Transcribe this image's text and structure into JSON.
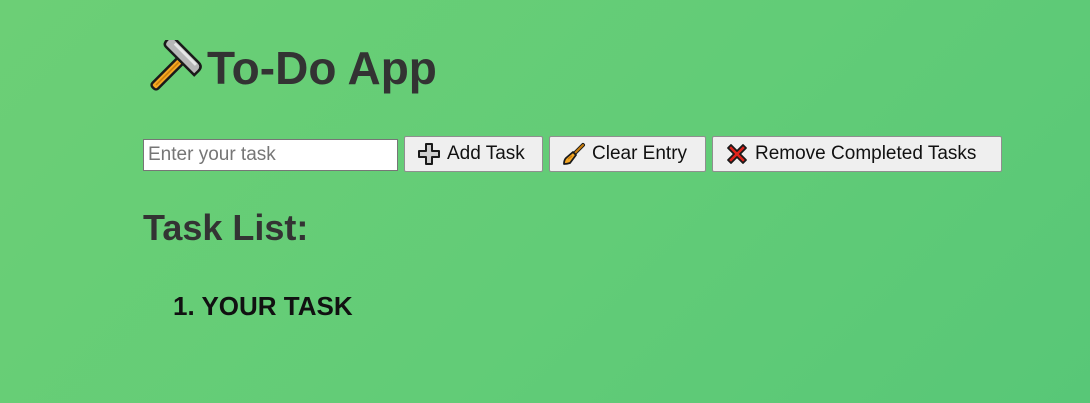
{
  "header": {
    "title": "To-Do App",
    "icon": "hammer-icon"
  },
  "toolbar": {
    "input": {
      "placeholder": "Enter your task",
      "value": ""
    },
    "add_label": "Add Task",
    "add_icon": "plus-icon",
    "clear_label": "Clear Entry",
    "clear_icon": "broom-icon",
    "remove_label": "Remove Completed Tasks",
    "remove_icon": "cross-mark-icon"
  },
  "task_section": {
    "heading": "Task List:",
    "items": [
      {
        "number": "1.",
        "text": "Your task"
      }
    ]
  },
  "colors": {
    "background_start": "#6ccf76",
    "background_end": "#58c777",
    "heading_text": "#333333",
    "cross_red": "#e0241b"
  }
}
